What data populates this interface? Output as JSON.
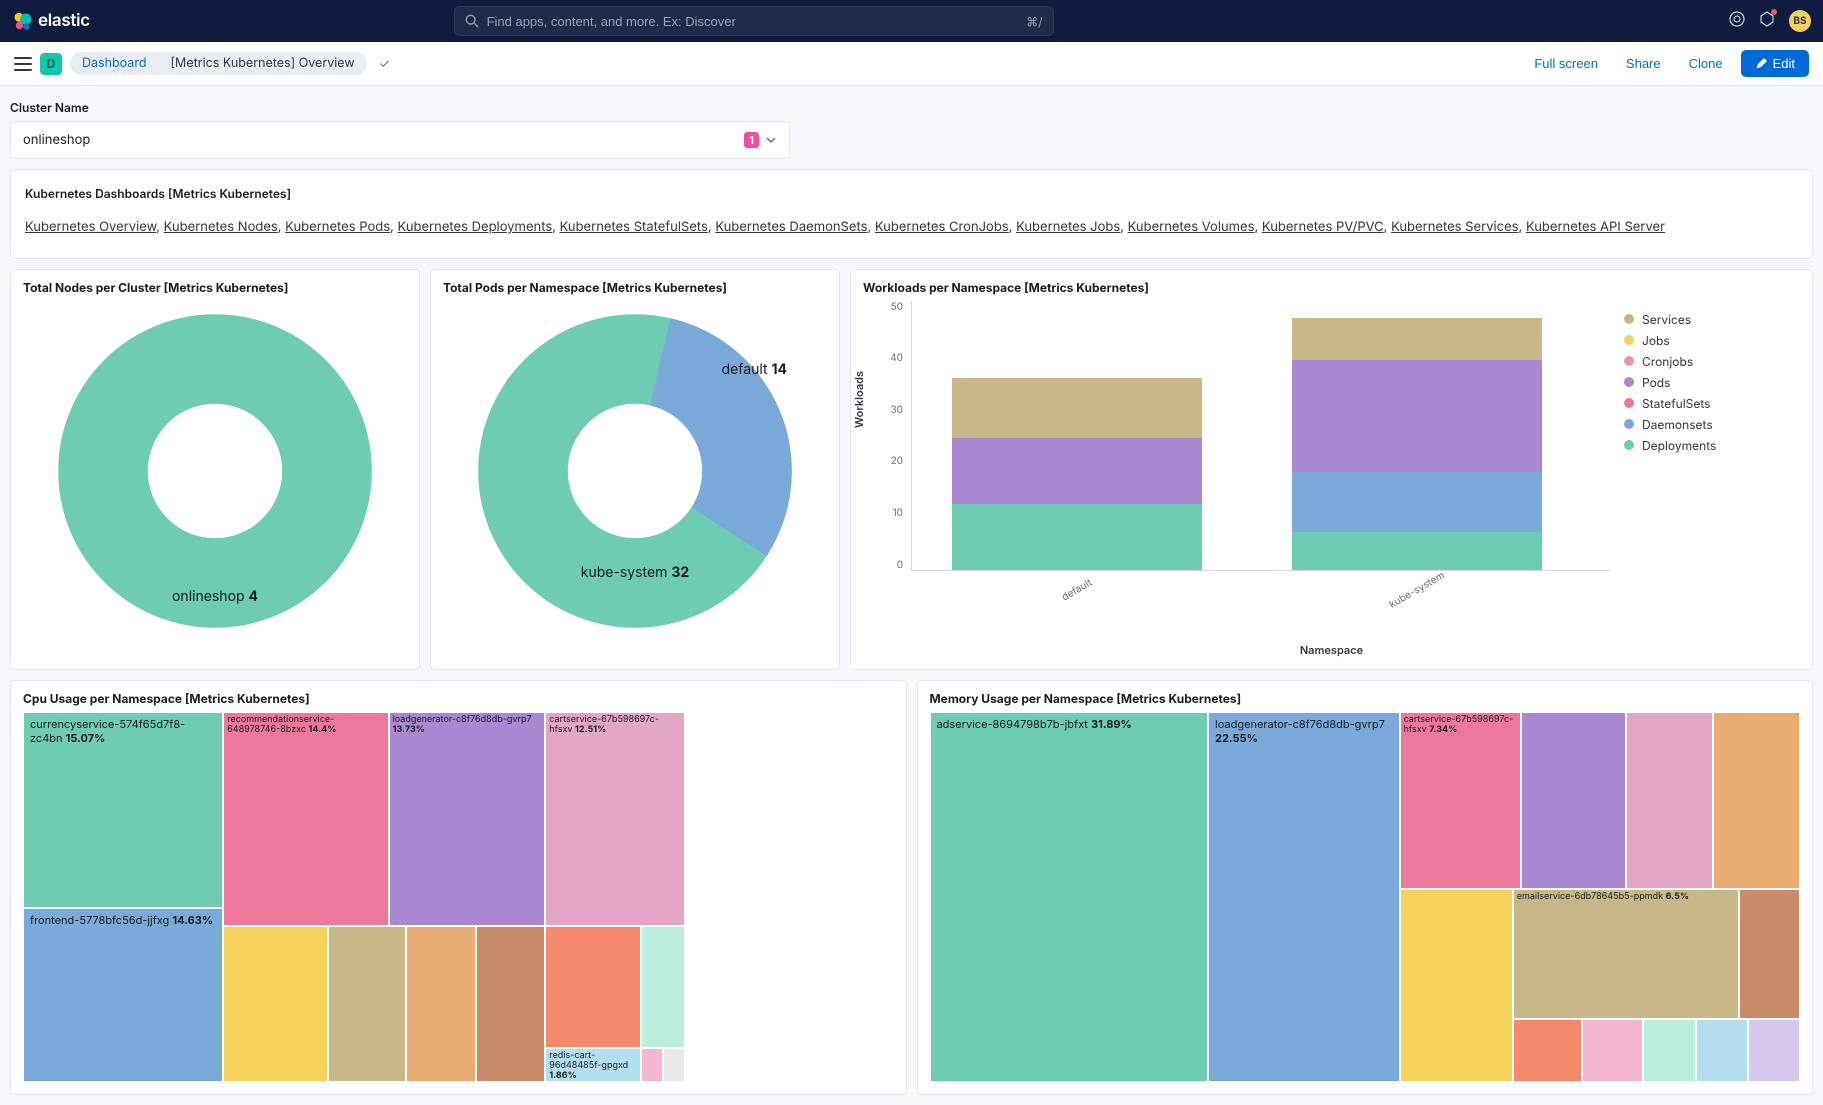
{
  "header": {
    "brand": "elastic",
    "search_placeholder": "Find apps, content, and more. Ex: Discover",
    "kbd_hint": "⌘/",
    "avatar": "BS"
  },
  "breadcrumb": {
    "space_letter": "D",
    "seg1": "Dashboard",
    "seg2": "[Metrics Kubernetes] Overview",
    "actions": {
      "fullscreen": "Full screen",
      "share": "Share",
      "clone": "Clone",
      "edit": "Edit"
    }
  },
  "cluster": {
    "label": "Cluster Name",
    "value": "onlineshop",
    "count": "1"
  },
  "dashlinks": {
    "title": "Kubernetes Dashboards [Metrics Kubernetes]",
    "items": [
      "Kubernetes Overview",
      "Kubernetes Nodes",
      "Kubernetes Pods",
      "Kubernetes Deployments",
      "Kubernetes StatefulSets",
      "Kubernetes DaemonSets",
      "Kubernetes CronJobs",
      "Kubernetes Jobs",
      "Kubernetes Volumes",
      "Kubernetes PV/PVC",
      "Kubernetes Services",
      "Kubernetes API Server"
    ]
  },
  "panels": {
    "nodes": {
      "title": "Total Nodes per Cluster [Metrics Kubernetes]",
      "label": "onlineshop",
      "val": "4"
    },
    "pods": {
      "title": "Total Pods per Namespace [Metrics Kubernetes]",
      "l1": "default",
      "v1": "14",
      "l2": "kube-system",
      "v2": "32"
    },
    "workloads": {
      "title": "Workloads per Namespace [Metrics Kubernetes]",
      "ylabel": "Workloads",
      "xlabel": "Namespace",
      "legend": [
        "Services",
        "Jobs",
        "Cronjobs",
        "Pods",
        "StatefulSets",
        "Daemonsets",
        "Deployments"
      ]
    },
    "cpu": {
      "title": "Cpu Usage per Namespace [Metrics Kubernetes]",
      "c1": "currencyservice-574f65d7f8-zc4bn",
      "p1": "15.07%",
      "c2": "frontend-5778bfc56d-jjfxg",
      "p2": "14.63%",
      "c3": "recommendationservice-648978746-8bzxc",
      "p3": "14.4%",
      "c4": "loadgenerator-c8f76d8db-gvrp7",
      "p4": "13.73%",
      "c5": "cartservice-67b598697c-hfsxv",
      "p5": "12.51%",
      "c6": "redis-cart-96d48485f-gpgxd",
      "p6": "1.86%"
    },
    "mem": {
      "title": "Memory Usage per Namespace [Metrics Kubernetes]",
      "m1": "adservice-8694798b7b-jbfxt",
      "mp1": "31.89%",
      "m2": "loadgenerator-c8f76d8db-gvrp7",
      "mp2": "22.55%",
      "m3": "cartservice-67b598697c-hfsxv",
      "mp3": "7.34%",
      "m4": "emailservice-6db78645b5-ppmdk",
      "mp4": "6.5%"
    }
  },
  "chart_data": [
    {
      "type": "pie",
      "title": "Total Nodes per Cluster [Metrics Kubernetes]",
      "series": [
        {
          "name": "onlineshop",
          "value": 4
        }
      ]
    },
    {
      "type": "pie",
      "title": "Total Pods per Namespace [Metrics Kubernetes]",
      "series": [
        {
          "name": "kube-system",
          "value": 32
        },
        {
          "name": "default",
          "value": 14
        }
      ]
    },
    {
      "type": "bar",
      "title": "Workloads per Namespace [Metrics Kubernetes]",
      "xlabel": "Namespace",
      "ylabel": "Workloads",
      "ylim": [
        0,
        55
      ],
      "categories": [
        "default",
        "kube-system"
      ],
      "series": [
        {
          "name": "Deployments",
          "values": [
            14,
            8
          ],
          "color": "#6dccb1"
        },
        {
          "name": "Daemonsets",
          "values": [
            0,
            13
          ],
          "color": "#79aad9"
        },
        {
          "name": "StatefulSets",
          "values": [
            0,
            0
          ],
          "color": "#ee789d"
        },
        {
          "name": "Pods",
          "values": [
            14,
            24
          ],
          "color": "#a987d1"
        },
        {
          "name": "Cronjobs",
          "values": [
            0,
            0
          ],
          "color": "#f191b6"
        },
        {
          "name": "Jobs",
          "values": [
            0,
            0
          ],
          "color": "#f5d35c"
        },
        {
          "name": "Services",
          "values": [
            13,
            9
          ],
          "color": "#c9b887"
        }
      ]
    },
    {
      "type": "treemap",
      "title": "Cpu Usage per Namespace [Metrics Kubernetes]",
      "items": [
        {
          "name": "currencyservice-574f65d7f8-zc4bn",
          "value": 15.07
        },
        {
          "name": "frontend-5778bfc56d-jjfxg",
          "value": 14.63
        },
        {
          "name": "recommendationservice-648978746-8bzxc",
          "value": 14.4
        },
        {
          "name": "loadgenerator-c8f76d8db-gvrp7",
          "value": 13.73
        },
        {
          "name": "cartservice-67b598697c-hfsxv",
          "value": 12.51
        },
        {
          "name": "redis-cart-96d48485f-gpgxd",
          "value": 1.86
        }
      ]
    },
    {
      "type": "treemap",
      "title": "Memory Usage per Namespace [Metrics Kubernetes]",
      "items": [
        {
          "name": "adservice-8694798b7b-jbfxt",
          "value": 31.89
        },
        {
          "name": "loadgenerator-c8f76d8db-gvrp7",
          "value": 22.55
        },
        {
          "name": "cartservice-67b598697c-hfsxv",
          "value": 7.34
        },
        {
          "name": "emailservice-6db78645b5-ppmdk",
          "value": 6.5
        }
      ]
    }
  ]
}
